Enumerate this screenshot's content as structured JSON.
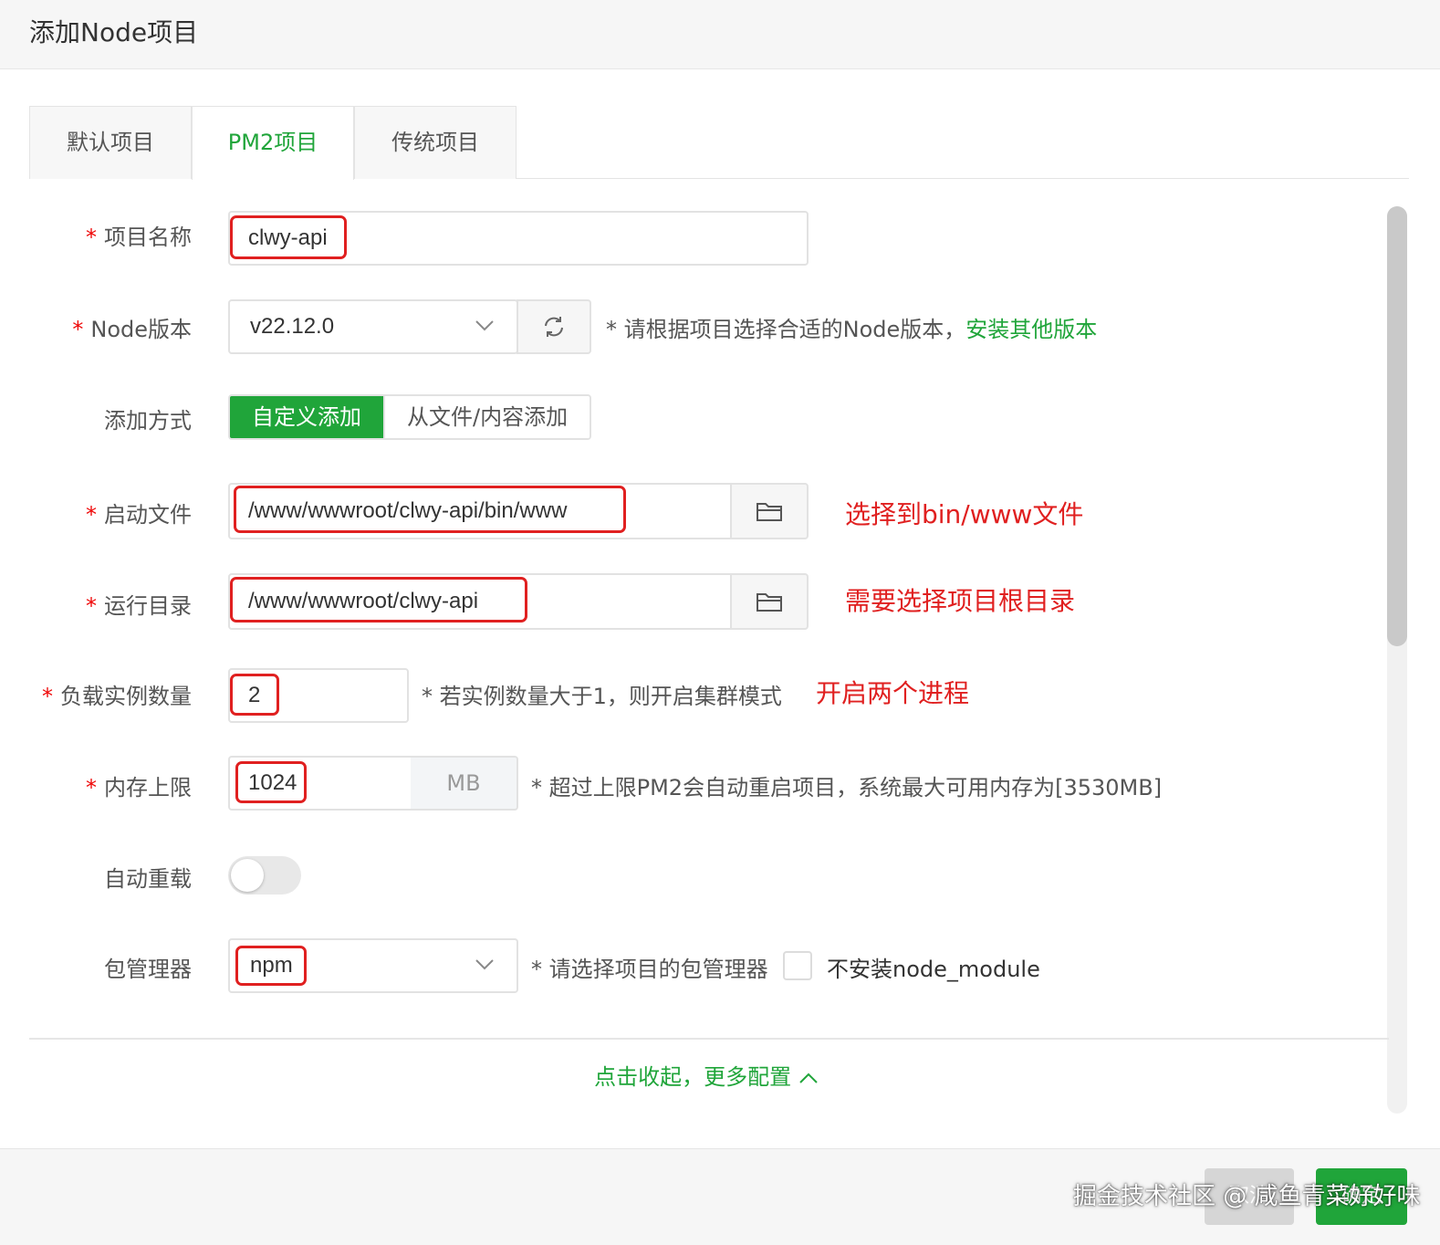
{
  "dialog": {
    "title": "添加Node项目"
  },
  "tabs": [
    {
      "label": "默认项目",
      "active": false
    },
    {
      "label": "PM2项目",
      "active": true
    },
    {
      "label": "传统项目",
      "active": false
    }
  ],
  "form": {
    "project_name": {
      "label": "项目名称",
      "required": "*",
      "value": "clwy-api"
    },
    "node_version": {
      "label": "Node版本",
      "required": "*",
      "value": "v22.12.0",
      "hint": "* 请根据项目选择合适的Node版本，",
      "link": "安装其他版本",
      "refresh_icon": "refresh-icon",
      "dropdown_icon": "chevron-down-icon"
    },
    "add_method": {
      "label": "添加方式",
      "options": [
        "自定义添加",
        "从文件/内容添加"
      ],
      "selected": "自定义添加"
    },
    "start_file": {
      "label": "启动文件",
      "required": "*",
      "value": "/www/wwwroot/clwy-api/bin/www",
      "note": "选择到bin/www文件",
      "icon": "folder-icon"
    },
    "run_dir": {
      "label": "运行目录",
      "required": "*",
      "value": "/www/wwwroot/clwy-api",
      "note": "需要选择项目根目录",
      "icon": "folder-icon"
    },
    "instances": {
      "label": "负载实例数量",
      "required": "*",
      "value": "2",
      "hint": "* 若实例数量大于1，则开启集群模式",
      "note": "开启两个进程"
    },
    "memory": {
      "label": "内存上限",
      "required": "*",
      "value": "1024",
      "unit": "MB",
      "hint": "* 超过上限PM2会自动重启项目，系统最大可用内存为[3530MB]"
    },
    "auto_reload": {
      "label": "自动重载",
      "enabled": false
    },
    "package_manager": {
      "label": "包管理器",
      "value": "npm",
      "hint": "* 请选择项目的包管理器",
      "checkbox_label": "不安装node_module",
      "checked": false
    }
  },
  "more_config": {
    "label": "点击收起，更多配置"
  },
  "footer": {
    "cancel_label": "取消",
    "confirm_label": "确定"
  },
  "watermark": "掘金技术社区 @ 咸鱼青菜好好味",
  "colors": {
    "accent": "#20a53a",
    "annotation": "#e02020",
    "required": "#ef0808"
  }
}
